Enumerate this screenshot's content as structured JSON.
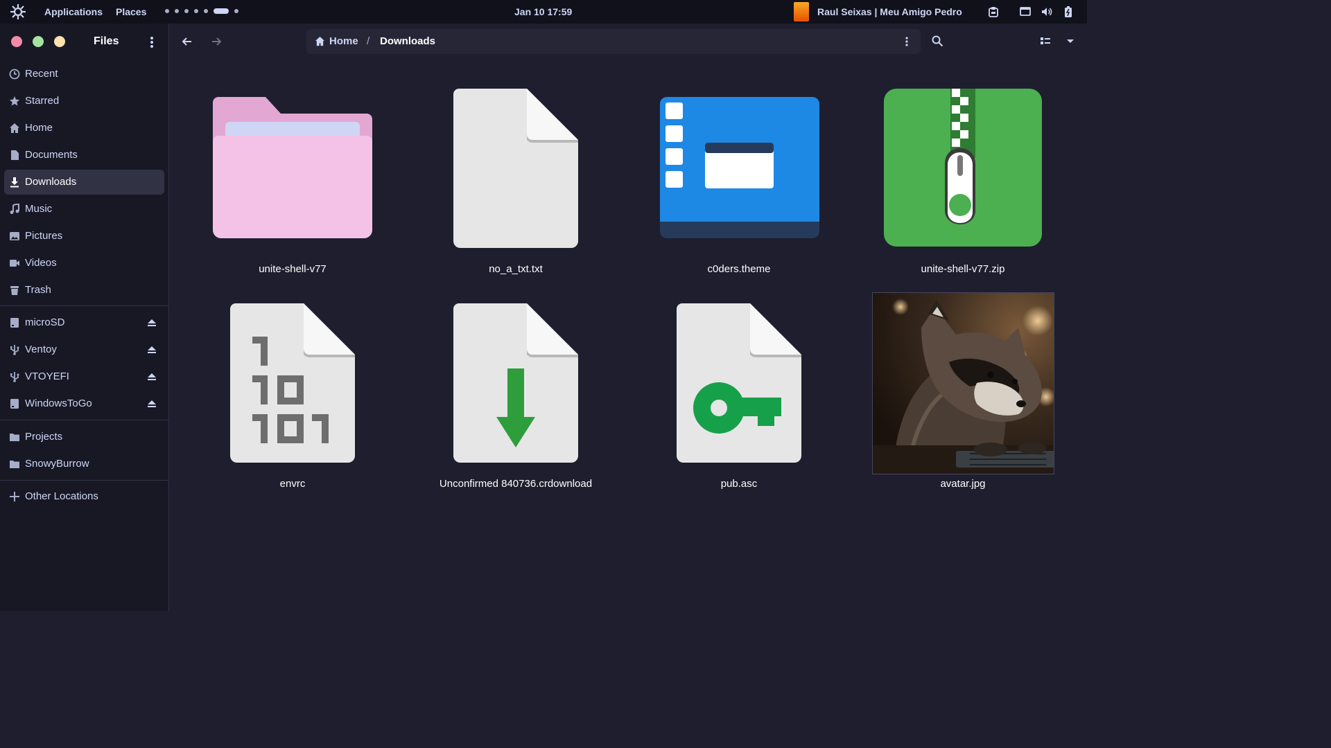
{
  "topbar": {
    "menus": [
      "Applications",
      "Places"
    ],
    "clock": "Jan 10  17:59",
    "media_title": "Raul Seixas | Meu Amigo Pedro",
    "tray_icons": [
      "clipboard-icon",
      "screen-icon",
      "volume-icon",
      "battery-icon"
    ]
  },
  "window": {
    "title": "Files"
  },
  "sidebar": {
    "places": [
      {
        "label": "Recent",
        "icon": "clock-icon"
      },
      {
        "label": "Starred",
        "icon": "star-icon"
      },
      {
        "label": "Home",
        "icon": "home-icon"
      },
      {
        "label": "Documents",
        "icon": "document-icon"
      },
      {
        "label": "Downloads",
        "icon": "download-icon",
        "active": true
      },
      {
        "label": "Music",
        "icon": "music-icon"
      },
      {
        "label": "Pictures",
        "icon": "picture-icon"
      },
      {
        "label": "Videos",
        "icon": "video-icon"
      },
      {
        "label": "Trash",
        "icon": "trash-icon"
      }
    ],
    "devices": [
      {
        "label": "microSD",
        "icon": "drive-icon"
      },
      {
        "label": "Ventoy",
        "icon": "usb-icon"
      },
      {
        "label": "VTOYEFI",
        "icon": "usb-icon"
      },
      {
        "label": "WindowsToGo",
        "icon": "drive-icon"
      }
    ],
    "bookmarks": [
      {
        "label": "Projects",
        "icon": "folder-icon"
      },
      {
        "label": "SnowyBurrow",
        "icon": "folder-icon"
      }
    ],
    "other": {
      "label": "Other Locations",
      "icon": "plus-icon"
    }
  },
  "pathbar": {
    "crumbs": [
      "Home",
      "Downloads"
    ],
    "separator": "/"
  },
  "files": [
    {
      "name": "unite-shell-v77",
      "icon": "folder-icon"
    },
    {
      "name": "no_a_txt.txt",
      "icon": "text-file-icon"
    },
    {
      "name": "c0ders.theme",
      "icon": "theme-file-icon"
    },
    {
      "name": "unite-shell-v77.zip",
      "icon": "zip-archive-icon"
    },
    {
      "name": "envrc",
      "icon": "binary-file-icon"
    },
    {
      "name": "Unconfirmed 840736.crdownload",
      "icon": "partial-download-icon"
    },
    {
      "name": "pub.asc",
      "icon": "key-file-icon"
    },
    {
      "name": "avatar.jpg",
      "icon": "image-thumbnail"
    }
  ],
  "colors": {
    "background": "#1e1e2e",
    "sidebar": "#181825",
    "topbar": "#11111b",
    "close": "#f38ba8",
    "minimize": "#a6e3a1",
    "maximize": "#f9e2af",
    "folder": "#f5c2e7",
    "theme_blue": "#1e88e5",
    "zip_green": "#4caf50",
    "download_green": "#2e9e3c",
    "key_green": "#17a04a"
  }
}
